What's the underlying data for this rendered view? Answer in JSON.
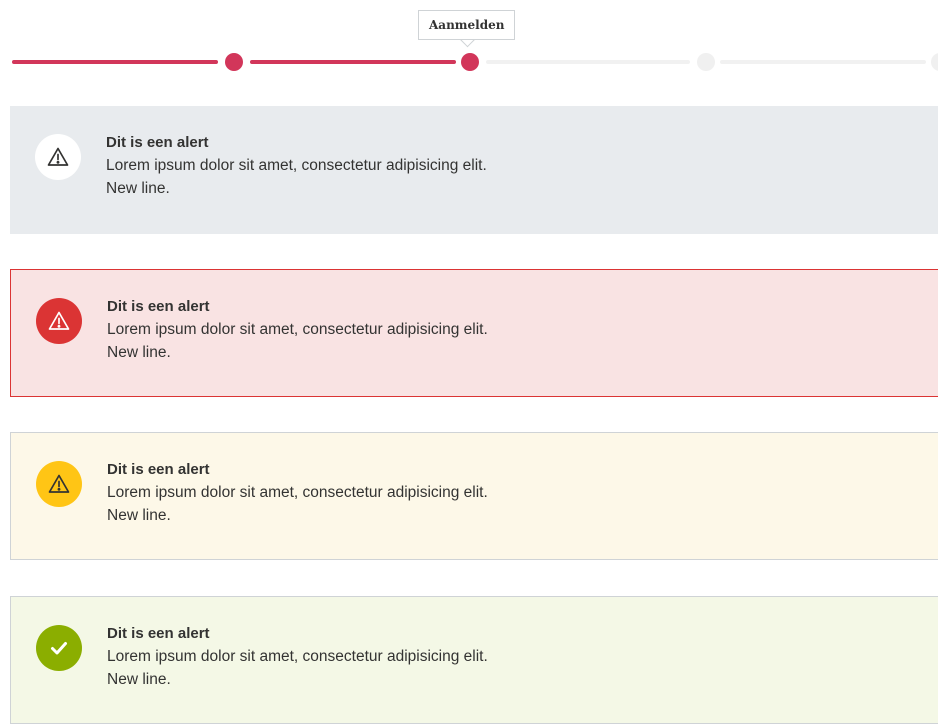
{
  "progress": {
    "current_step_tooltip": "Aanmelden",
    "steps_total": 5,
    "steps_done": 2,
    "current_step": 2,
    "accent_color": "#d2365a"
  },
  "alerts": [
    {
      "variant": "info",
      "icon": "warning-triangle-icon",
      "color": "#e8ebee",
      "title": "Dit is een alert",
      "line1": "Lorem ipsum dolor sit amet, consectetur adipisicing elit.",
      "line2": "New line."
    },
    {
      "variant": "error",
      "icon": "warning-triangle-icon",
      "color": "#db3434",
      "title": "Dit is een alert",
      "line1": "Lorem ipsum dolor sit amet, consectetur adipisicing elit.",
      "line2": "New line."
    },
    {
      "variant": "warning",
      "icon": "warning-triangle-icon",
      "color": "#ffc515",
      "title": "Dit is een alert",
      "line1": "Lorem ipsum dolor sit amet, consectetur adipisicing elit.",
      "line2": "New line."
    },
    {
      "variant": "success",
      "icon": "checkmark-icon",
      "color": "#8bae00",
      "title": "Dit is een alert",
      "line1": "Lorem ipsum dolor sit amet, consectetur adipisicing elit.",
      "line2": "New line."
    }
  ]
}
